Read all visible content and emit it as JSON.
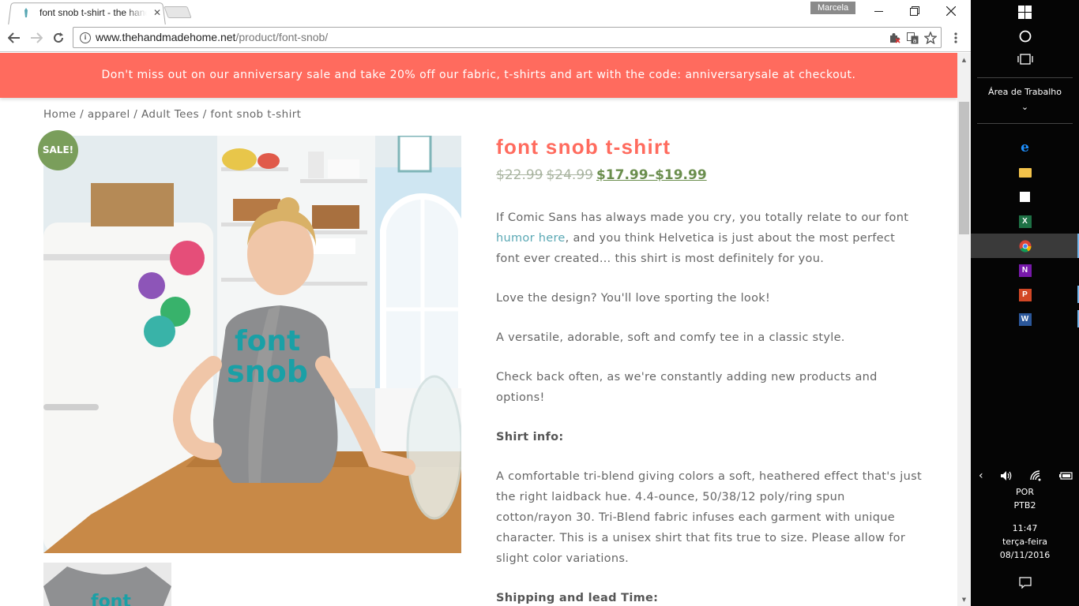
{
  "browser": {
    "tab_title": "font snob t-shirt - the handmade home",
    "tab_close": "✕",
    "user_badge": "Marcela",
    "url_host": "www.thehandmadehome.net",
    "url_path": "/product/font-snob/",
    "info_glyph": "i"
  },
  "page": {
    "banner": "Don't miss out on our anniversary sale and take 20% off our fabric, t-shirts and art with the code: anniversarysale at checkout.",
    "breadcrumb": {
      "home": "Home",
      "cat": "apparel",
      "sub": "Adult Tees",
      "current": "font snob t-shirt",
      "sep": " / "
    },
    "sale_badge": "SALE!",
    "title": "font snob t-shirt",
    "price_old_1": "$22.99",
    "price_old_2": "$24.99",
    "price_new": "$17.99–$19.99",
    "desc_p1_a": "If Comic Sans has always made you cry, you totally relate to our font",
    "desc_p1_link": "humor here",
    "desc_p1_b": ", and you think Helvetica is just about the most perfect font ever created… this shirt is most definitely for you.",
    "desc_p2": "Love the design? You'll love sporting the look!",
    "desc_p3": "A versatile, adorable, soft and comfy tee in a classic style.",
    "desc_p4": "Check back often, as we're constantly adding new products and options!",
    "desc_h1": "Shirt info:",
    "desc_p5": "A comfortable tri-blend giving colors a soft, heathered effect that's just the right laidback hue. 4.4-ounce, 50/38/12 poly/ring spun cotton/rayon 30. Tri-Blend fabric infuses each garment with unique character. This is a unisex shirt that fits true to size. Please allow for slight color variations.",
    "desc_h2": "Shipping and lead Time:",
    "shirt_print_1": "font",
    "shirt_print_2": "snob",
    "thumb_print": "font"
  },
  "taskbar": {
    "desktop_label": "Área de Trabalho",
    "lang_1": "POR",
    "lang_2": "PTB2",
    "time": "11:47",
    "day": "terça-feira",
    "date": "08/11/2016",
    "colors": {
      "edge": "#1e90ff",
      "excel": "#1e7145",
      "onenote": "#7719aa",
      "powerpoint": "#d24726",
      "word": "#2b579a",
      "explorer": "#f3c34b"
    }
  }
}
